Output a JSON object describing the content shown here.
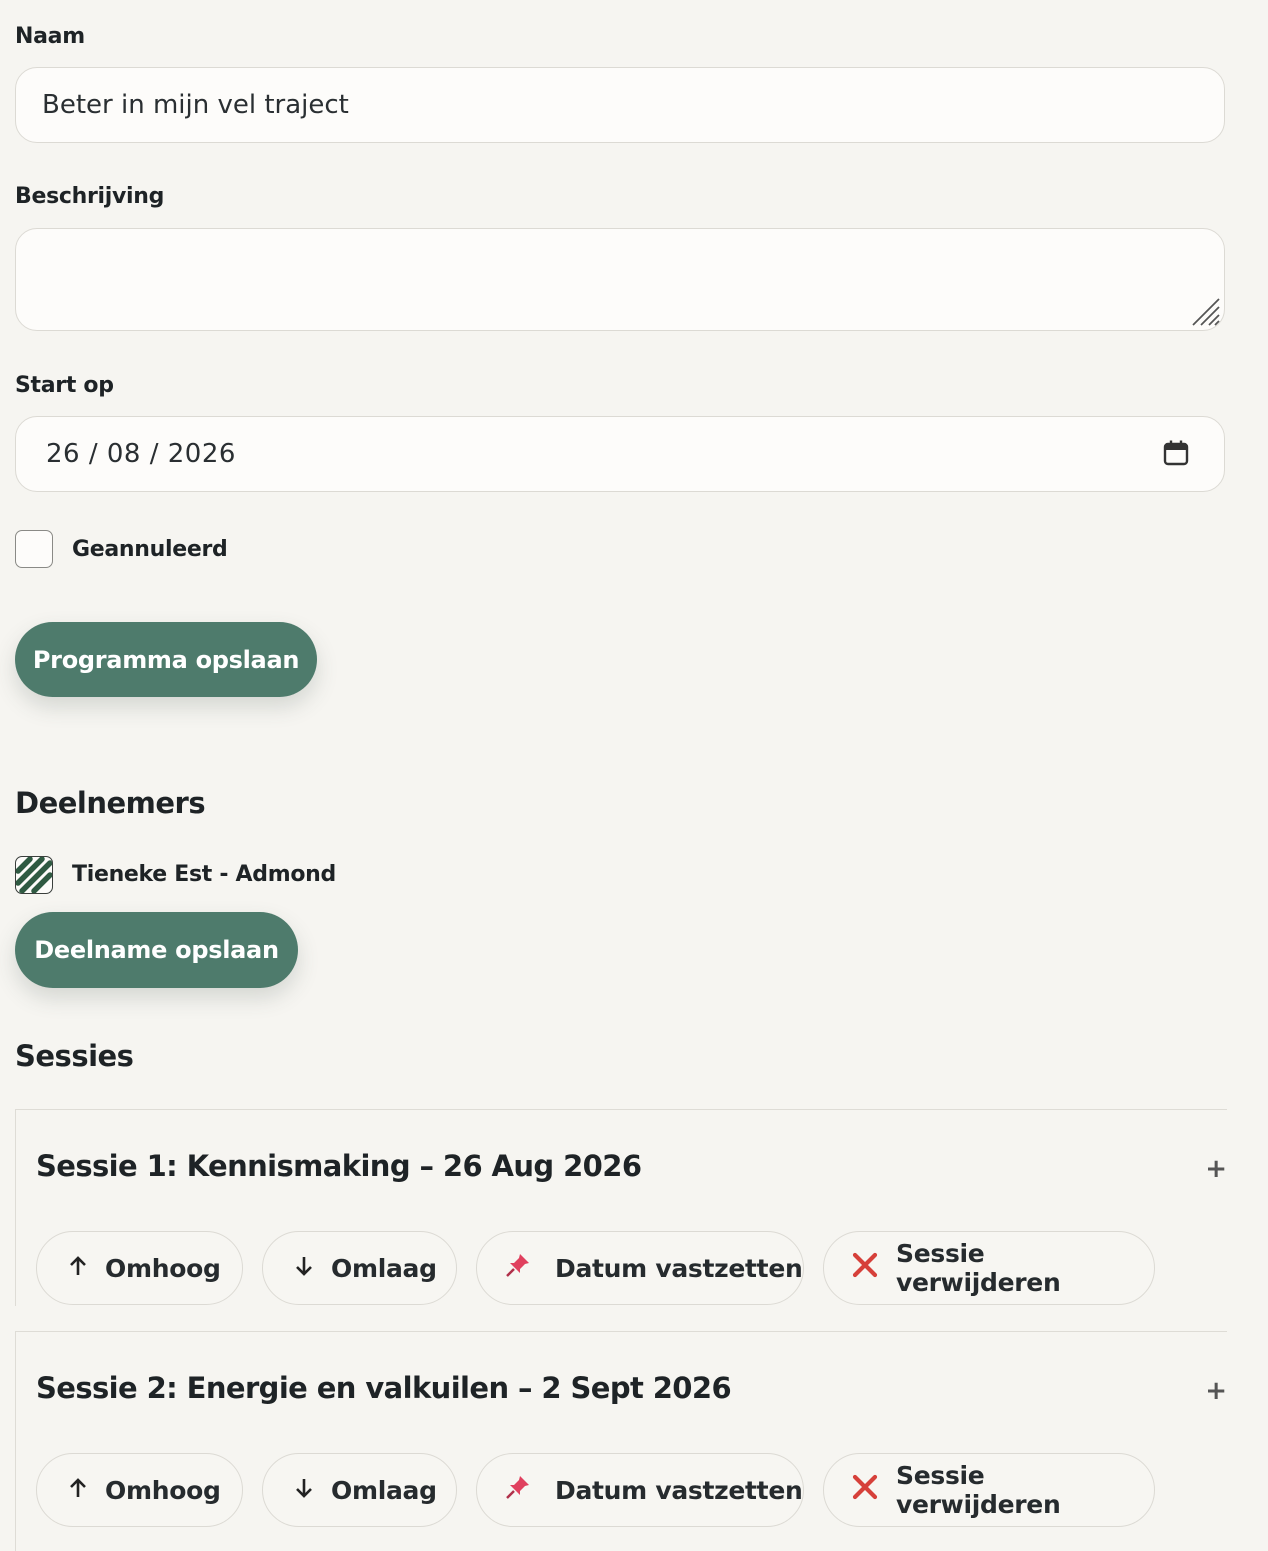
{
  "form": {
    "name_label": "Naam",
    "name_value": "Beter in mijn vel traject",
    "description_label": "Beschrijving",
    "description_value": "",
    "start_label": "Start op",
    "start_value": "26 / 08 / 2026",
    "cancelled_label": "Geannuleerd",
    "cancelled_checked": false,
    "save_program_label": "Programma opslaan"
  },
  "participants": {
    "heading": "Deelnemers",
    "items": [
      {
        "label": "Tieneke Est - Admond",
        "checked": true
      }
    ],
    "save_label": "Deelname opslaan"
  },
  "sessions": {
    "heading": "Sessies",
    "items": [
      {
        "title": "Sessie 1: Kennismaking – 26 Aug 2026",
        "expand": "+",
        "up_label": "Omhoog",
        "down_label": "Omlaag",
        "pin_label": "Datum vastzetten",
        "delete_label": "Sessie verwijderen"
      },
      {
        "title": "Sessie 2: Energie en valkuilen – 2 Sept 2026",
        "expand": "+",
        "up_label": "Omhoog",
        "down_label": "Omlaag",
        "pin_label": "Datum vastzetten",
        "delete_label": "Sessie verwijderen"
      }
    ]
  },
  "colors": {
    "primary": "#4e7b6c",
    "background": "#f6f5f1",
    "delete_icon": "#d6403a",
    "pin_icon": "#e0405e"
  },
  "icons": {
    "up": "arrow-up-icon",
    "down": "arrow-down-icon",
    "pin": "pushpin-icon",
    "delete": "cross-icon",
    "calendar": "calendar-icon"
  }
}
